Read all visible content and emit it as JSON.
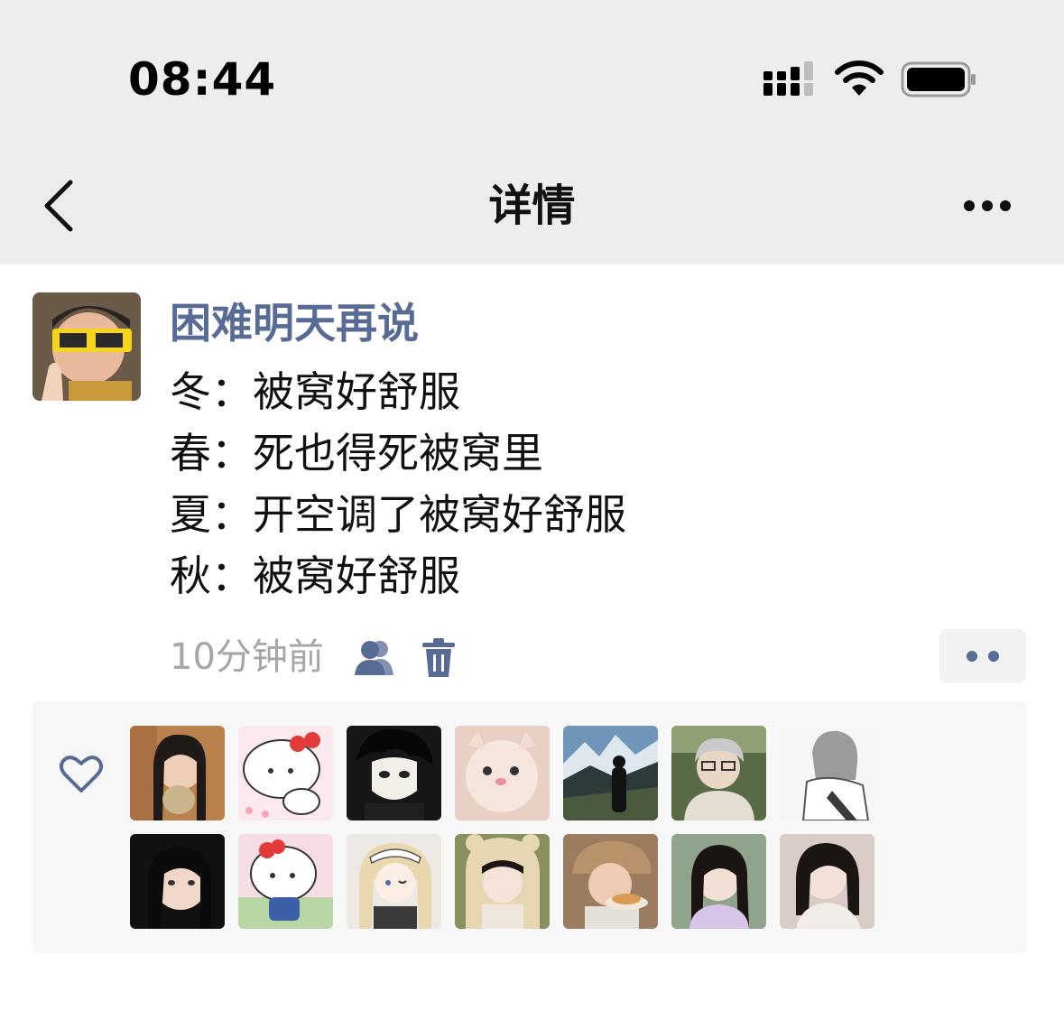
{
  "status_bar": {
    "time": "08:44",
    "signal_icon": "cellular-signal-icon",
    "wifi_icon": "wifi-icon",
    "battery_icon": "battery-icon"
  },
  "nav": {
    "title": "详情",
    "back_icon": "chevron-left-icon",
    "more_icon": "more-horizontal-icon"
  },
  "post": {
    "author": "困难明天再说",
    "lines": [
      "冬：被窝好舒服",
      "春：死也得死被窝里",
      "夏：开空调了被窝好舒服",
      "秋：被窝好舒服"
    ],
    "time": "10分钟前",
    "visibility_icon": "friends-visibility-icon",
    "delete_icon": "trash-icon",
    "action_icon": "more-dots-icon"
  },
  "likes": {
    "heart_icon": "heart-outline-icon",
    "count": 14
  },
  "colors": {
    "link_blue": "#576b95",
    "nav_bg": "#ededed",
    "meta_gray": "#a6a6a6",
    "likes_bg": "#f7f7f7"
  }
}
